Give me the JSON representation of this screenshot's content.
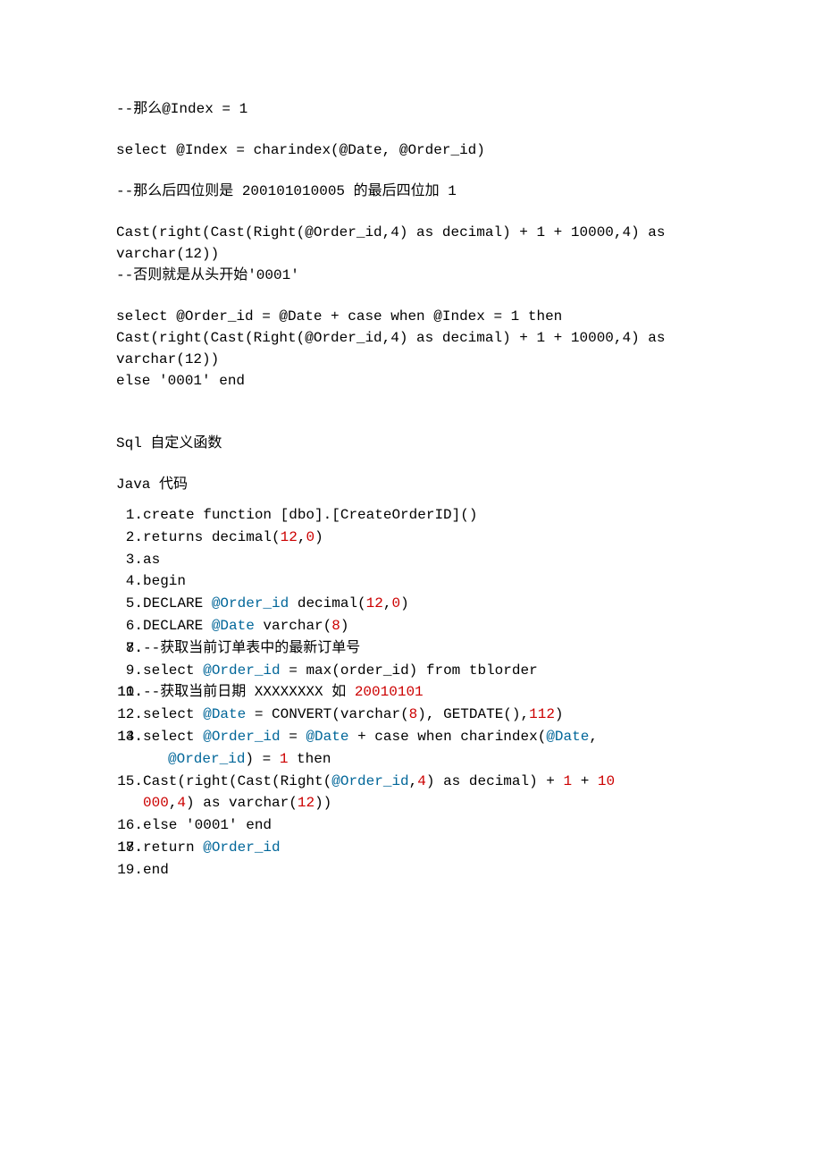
{
  "p1": "--那么@Index = 1",
  "p2": "select @Index = charindex(@Date, @Order_id)",
  "p3_a": "--那么后四位则是 ",
  "p3_b": "200101010005",
  "p3_c": " 的最后四位加 ",
  "p3_d": "1",
  "p4": "Cast(right(Cast(Right(@Order_id,4) as decimal) + 1 + 10000,4) as varchar(12))\n--否则就是从头开始'0001'",
  "p5": "select @Order_id = @Date + case when @Index = 1 then Cast(right(Cast(Right(@Order_id,4) as decimal) + 1 + 10000,4) as varchar(12))\nelse '0001' end",
  "p6": "Sql 自定义函数",
  "p7": "Java 代码",
  "code": {
    "l1_a": "create  function  [dbo].[CreateOrderID]()",
    "l2_a": "returns  decimal",
    "l2_b": "(",
    "l2_c": "12",
    "l2_d": ",",
    "l2_e": "0",
    "l2_f": ")",
    "l3": "as",
    "l4": "begin",
    "l5_a": "  DECLARE  ",
    "l5_b": "@Order_id",
    "l5_c": "  decimal(",
    "l5_d": "12",
    "l5_e": ",",
    "l5_f": "0",
    "l5_g": ")",
    "l6_a": "  DECLARE  ",
    "l6_b": "@Date",
    "l6_c": "  varchar(",
    "l6_d": "8",
    "l6_e": ")",
    "l7": " ",
    "l8": "  --获取当前订单表中的最新订单号",
    "l9_a": "  select  ",
    "l9_b": "@Order_id",
    "l9_c": "  =  max(order_id)  from  tblorder",
    "l10": " ",
    "l11_a": "  --获取当前日期 XXXXXXXX 如 ",
    "l11_b": "20010101",
    "l12_a": "  select  ",
    "l12_b": "@Date",
    "l12_c": "  =  CONVERT(varchar(",
    "l12_d": "8",
    "l12_e": "),  GETDATE(),",
    "l12_f": "112",
    "l12_g": ")",
    "l13": " ",
    "l14_a": "  select  ",
    "l14_b": "@Order_id",
    "l14_c": "  =  ",
    "l14_d": "@Date",
    "l14_e": "  +  case  when  charindex(",
    "l14_f": "@Date",
    "l14_g": ", ",
    "l14_h": "@Order_id",
    "l14_i": ")  =  ",
    "l14_j": "1",
    "l14_k": "  then",
    "l15_a": "  Cast(right(Cast(Right(",
    "l15_b": "@Order_id",
    "l15_c": ",",
    "l15_d": "4",
    "l15_e": ")  as  decimal)  +  ",
    "l15_f": "1",
    "l15_g": "  +  ",
    "l15_h": "10",
    "l15_i": "000",
    "l15_j": ",",
    "l15_k": "4",
    "l15_l": ")  as  varchar(",
    "l15_m": "12",
    "l15_n": "))",
    "l16": "  else  '0001'  end",
    "l17": " ",
    "l18_a": "       return  ",
    "l18_b": "@Order_id",
    "l19": "end"
  }
}
